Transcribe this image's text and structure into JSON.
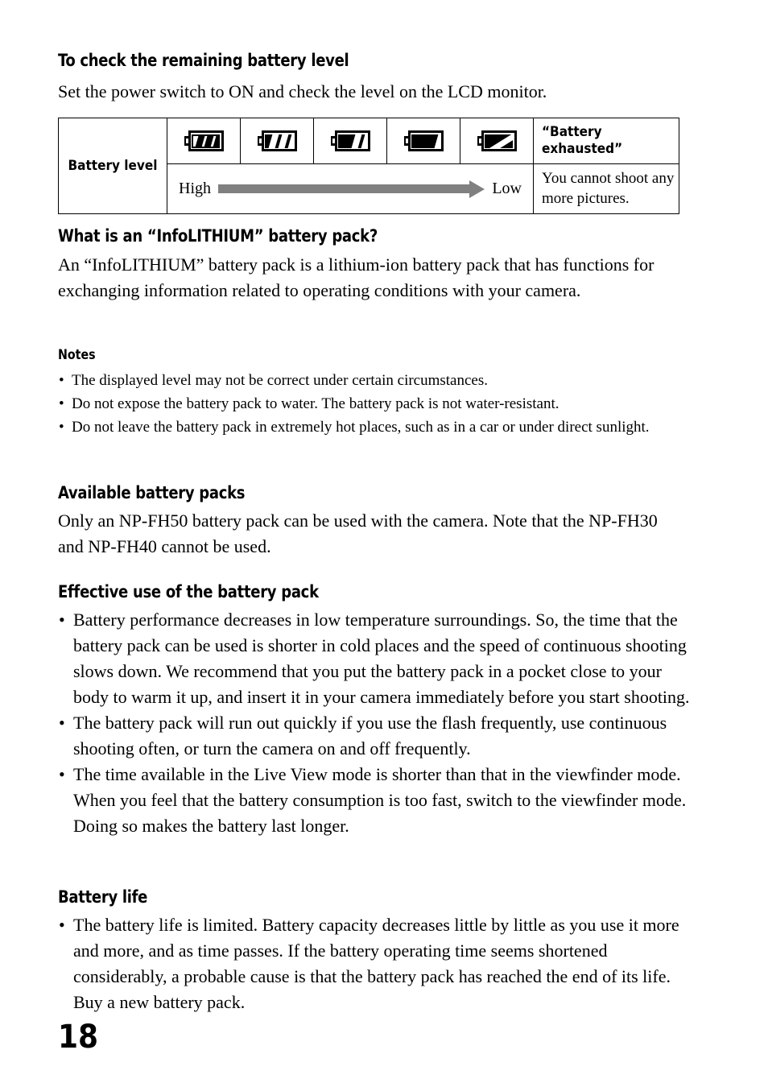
{
  "document": {
    "page_number": "18"
  },
  "sections": [
    {
      "id": "check-level",
      "heading": "To check the remaining battery level",
      "paragraph": "Set the power switch to ON and check the level on the LCD monitor."
    },
    {
      "id": "infolithium",
      "heading": "What is an “InfoLITHIUM” battery pack?",
      "paragraph": "An “InfoLITHIUM” battery pack is a lithium-ion battery pack that has functions for exchanging information related to operating conditions with your camera."
    },
    {
      "id": "available-packs",
      "heading": "Available battery packs",
      "paragraph": "Only an NP-FH50 battery pack can be used with the camera. Note that the NP-FH30 and NP-FH40 cannot be used."
    },
    {
      "id": "effective-use",
      "heading": "Effective use of the battery pack"
    },
    {
      "id": "battery-life",
      "heading": "Battery life"
    }
  ],
  "battery_table": {
    "row_label": "Battery level",
    "exhausted_label": "“Battery exhausted”",
    "exhausted_note": "You cannot shoot any more pictures.",
    "scale_high": "High",
    "scale_low": "Low",
    "arrow_color": "#808080",
    "icons": [
      {
        "name": "battery-icon-full-outline",
        "level": 3,
        "style": "outline",
        "struck": false
      },
      {
        "name": "battery-icon-three-bars",
        "level": 3,
        "style": "filled",
        "struck": false
      },
      {
        "name": "battery-icon-two-bars",
        "level": 2,
        "style": "filled",
        "struck": false
      },
      {
        "name": "battery-icon-one-bar",
        "level": 1,
        "style": "filled",
        "struck": false
      },
      {
        "name": "battery-icon-empty-struck",
        "level": 0,
        "style": "filled",
        "struck": true
      }
    ]
  },
  "notes": {
    "heading": "Notes",
    "items": [
      "The displayed level may not be correct under certain circumstances.",
      "Do not expose the battery pack to water. The battery pack is not water-resistant.",
      "Do not leave the battery pack in extremely hot places, such as in a car or under direct sunlight."
    ]
  },
  "effective_use_items": [
    "Battery performance decreases in low temperature surroundings. So, the time that the battery pack can be used is shorter in cold places and the speed of continuous shooting slows down. We recommend that you put the battery pack in a pocket close to your body to warm it up, and insert it in your camera immediately before you start shooting.",
    "The battery pack will run out quickly if you use the flash frequently, use continuous shooting often, or turn the camera on and off frequently.",
    "The time available in the Live View mode is shorter than that in the viewfinder mode. When you feel that the battery consumption is too fast, switch to the viewfinder mode. Doing so makes the battery last longer."
  ],
  "battery_life_items": [
    "The battery life is limited. Battery capacity decreases little by little as you use it more and more, and as time passes. If the battery operating time seems shortened considerably, a probable cause is that the battery pack has reached the end of its life. Buy a new battery pack."
  ],
  "bullet_glyph": "•"
}
